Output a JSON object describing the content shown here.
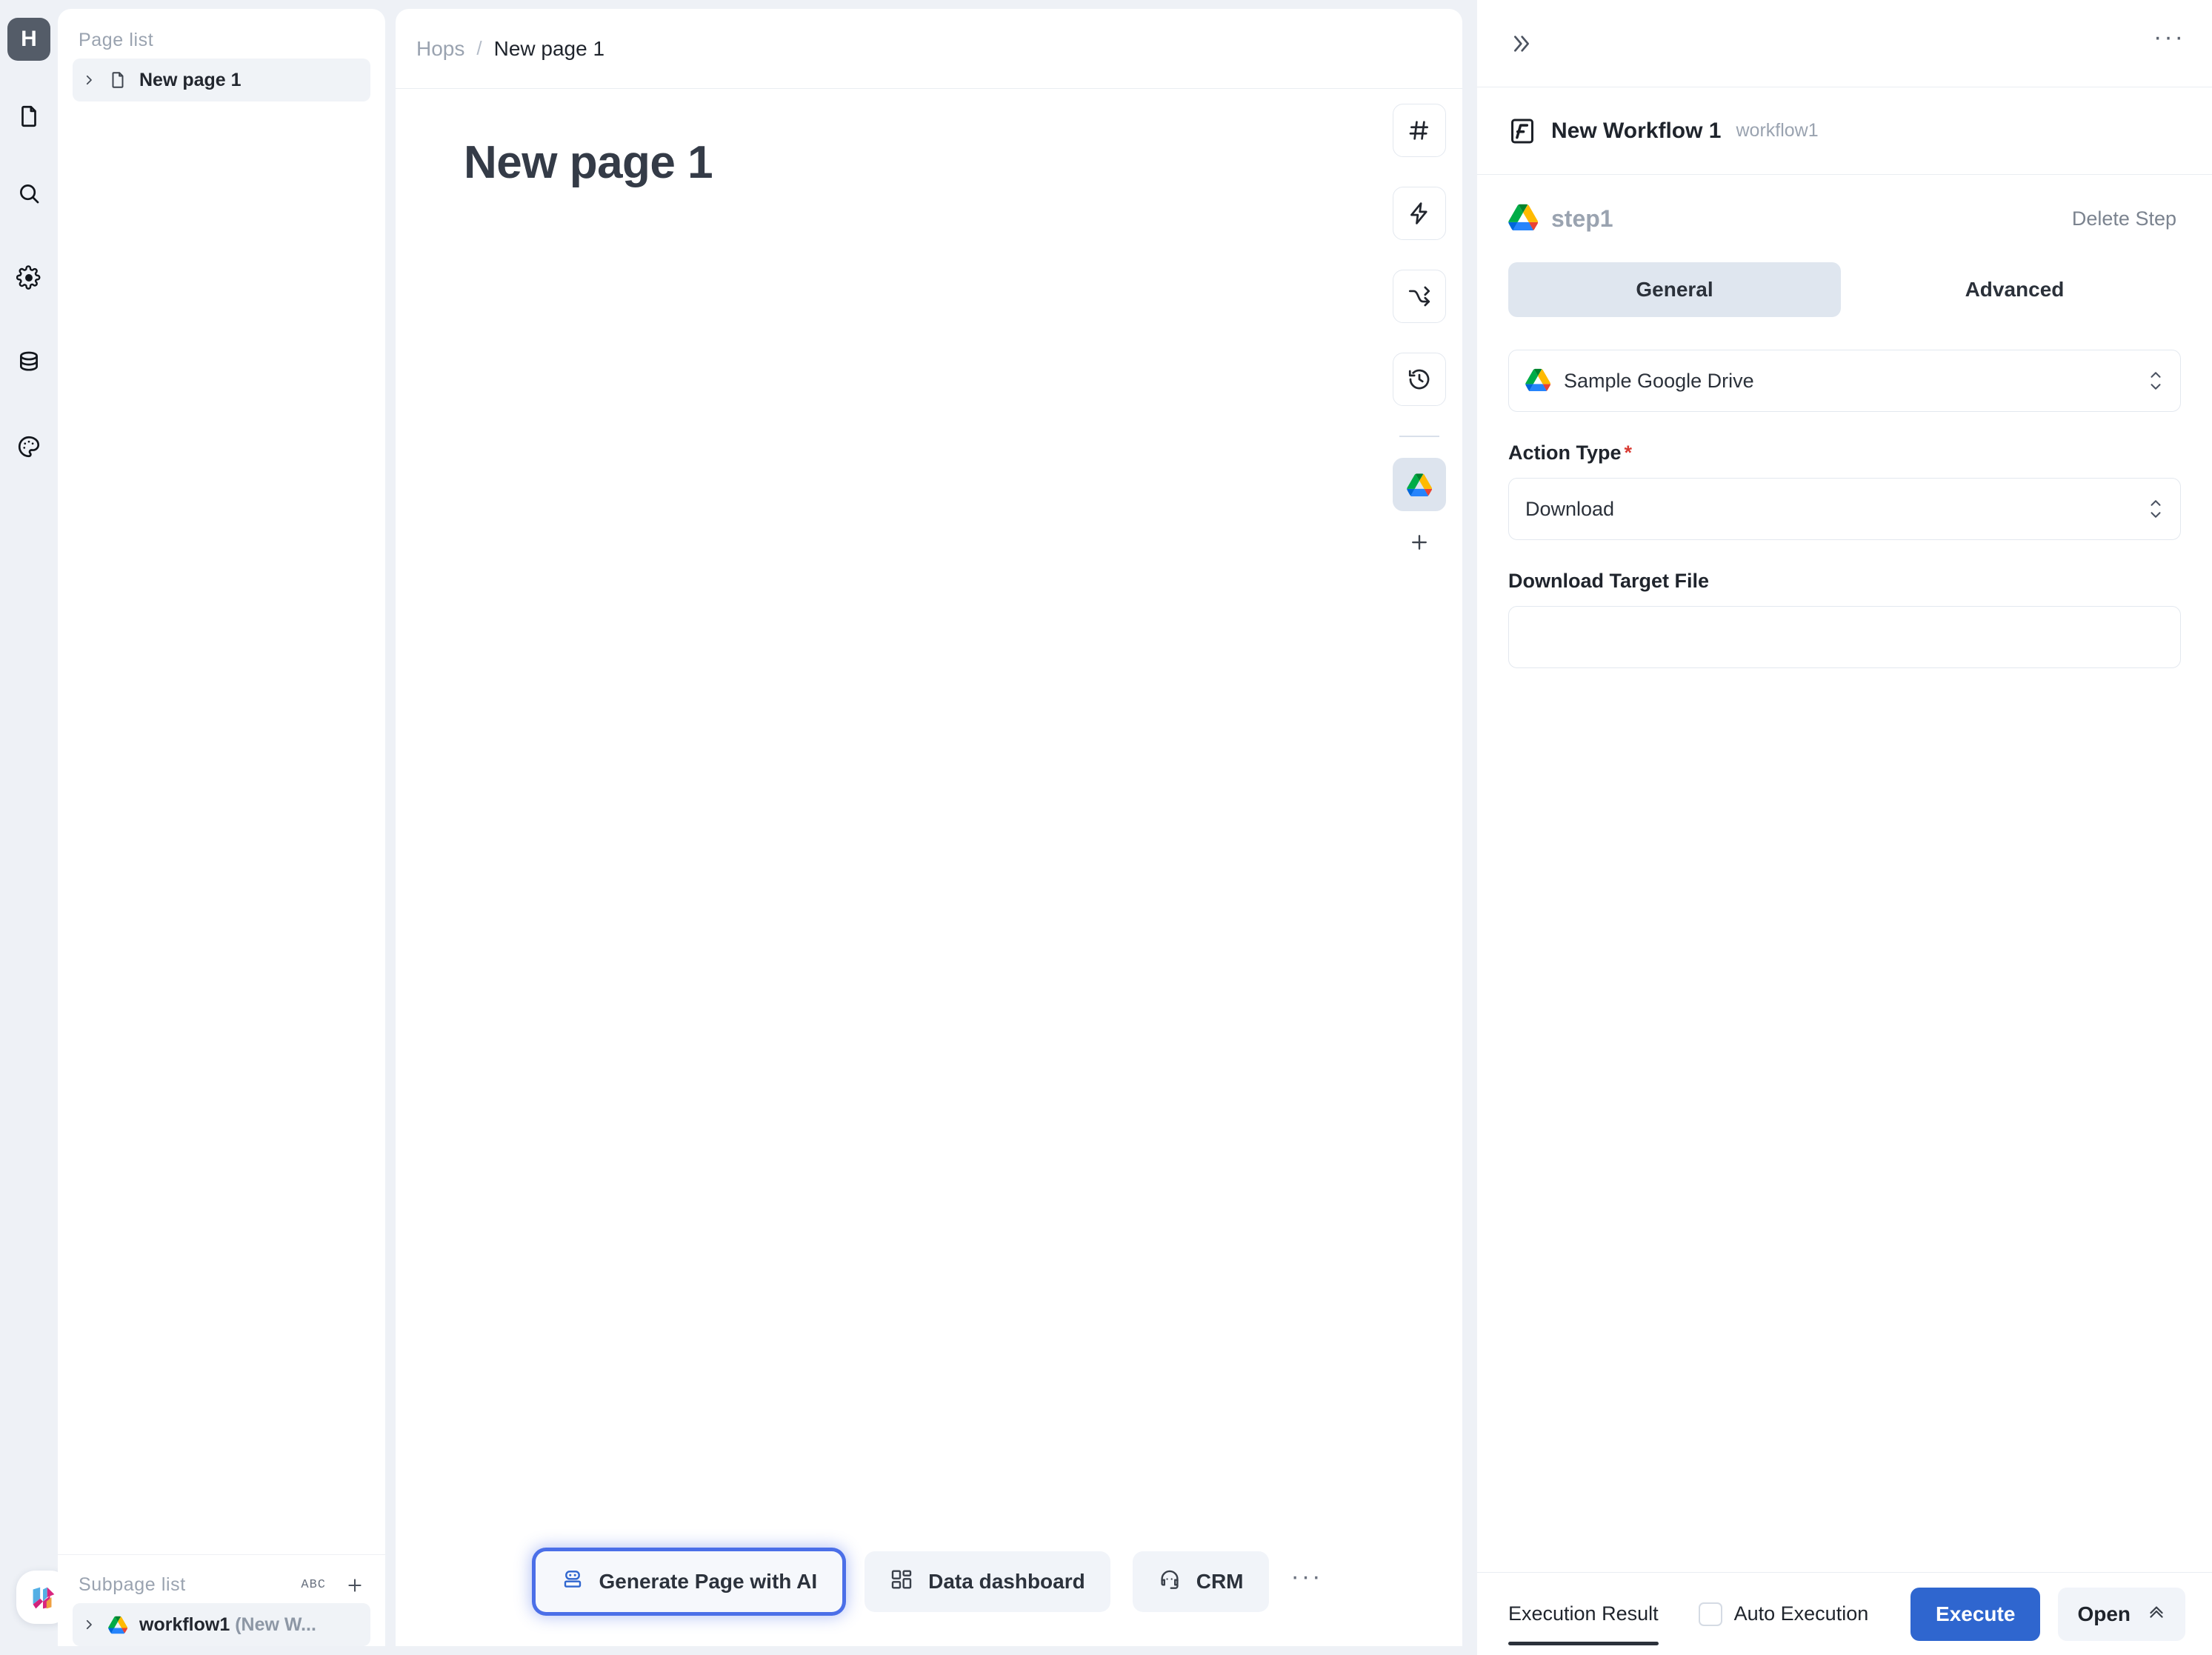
{
  "rail": {
    "logo_letter": "H",
    "items": [
      {
        "name": "pages-icon",
        "label": "Pages"
      },
      {
        "name": "search-icon",
        "label": "Search"
      },
      {
        "name": "gear-icon",
        "label": "Settings"
      },
      {
        "name": "database-icon",
        "label": "Data"
      },
      {
        "name": "palette-icon",
        "label": "Theme"
      }
    ],
    "bottom_logo": "app-logo"
  },
  "page_panel": {
    "caption": "Page list",
    "items": [
      {
        "label": "New page 1",
        "icon": "file-icon",
        "selected": true
      }
    ],
    "subpage": {
      "caption": "Subpage list",
      "sort_label": "ABC",
      "add_label": "+",
      "items": [
        {
          "label": "workflow1 ",
          "suffix": "(New W...",
          "icon": "google-drive-icon",
          "selected": true
        }
      ]
    }
  },
  "canvas": {
    "breadcrumb": {
      "root": "Hops",
      "sep": "/",
      "current": "New page 1"
    },
    "title": "New page 1",
    "tools": [
      {
        "name": "hash-icon",
        "active": false
      },
      {
        "name": "lightning-icon",
        "active": false
      },
      {
        "name": "shuffle-icon",
        "active": false
      },
      {
        "name": "history-icon",
        "active": false
      },
      {
        "name": "google-drive-icon",
        "active": true
      }
    ],
    "add_tool_label": "+",
    "bottom_buttons": [
      {
        "label": "Generate Page with AI",
        "icon": "robot-icon",
        "primary": true
      },
      {
        "label": "Data dashboard",
        "icon": "dashboard-icon",
        "primary": false
      },
      {
        "label": "CRM",
        "icon": "headset-icon",
        "primary": false
      }
    ],
    "bottom_more": "···"
  },
  "workflow": {
    "collapse_label": "»",
    "more_label": "···",
    "name": "New Workflow 1",
    "slug": "workflow1",
    "step": {
      "name": "step1",
      "icon": "google-drive-icon",
      "delete_label": "Delete Step"
    },
    "tabs": [
      {
        "label": "General",
        "active": true
      },
      {
        "label": "Advanced",
        "active": false
      }
    ],
    "connection": {
      "value": "Sample Google Drive",
      "icon": "google-drive-icon"
    },
    "action_type": {
      "label": "Action Type",
      "required": "*",
      "value": "Download"
    },
    "download_target": {
      "label": "Download Target File",
      "value": "",
      "placeholder": ""
    },
    "footer": {
      "result_tab": "Execution Result",
      "auto_exec_label": "Auto Execution",
      "auto_exec_checked": false,
      "execute_label": "Execute",
      "open_label": "Open"
    }
  },
  "colors": {
    "accent_blue": "#2f66cf",
    "highlight_ring": "#4b6fe8",
    "required_red": "#d93b33",
    "rail_logo_bg": "#545c68"
  }
}
